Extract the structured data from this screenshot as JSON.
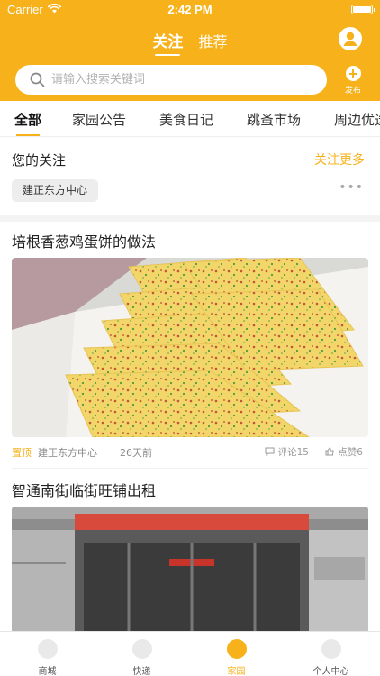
{
  "status": {
    "carrier": "Carrier",
    "time": "2:42 PM"
  },
  "header": {
    "tabs": [
      {
        "label": "关注",
        "active": true
      },
      {
        "label": "推荐",
        "active": false
      }
    ],
    "search_placeholder": "请输入搜索关键词",
    "publish_label": "发布"
  },
  "categories": [
    "全部",
    "家园公告",
    "美食日记",
    "跳蚤市场",
    "周边优选"
  ],
  "follow": {
    "title": "您的关注",
    "more": "关注更多",
    "tag": "建正东方中心"
  },
  "posts": [
    {
      "title": "培根香葱鸡蛋饼的做法",
      "pinned": "置顶",
      "community": "建正东方中心",
      "time": "26天前",
      "comments": "评论15",
      "likes": "点赞6"
    },
    {
      "title": "智通南街临街旺铺出租"
    }
  ],
  "tabbar": [
    {
      "label": "商城",
      "icon": "mall-icon",
      "active": false
    },
    {
      "label": "快递",
      "icon": "package-icon",
      "active": false
    },
    {
      "label": "家园",
      "icon": "home-icon",
      "active": true
    },
    {
      "label": "个人中心",
      "icon": "profile-icon",
      "active": false
    }
  ],
  "colors": {
    "accent": "#f7b21b",
    "divider": "#f4f4f4"
  }
}
